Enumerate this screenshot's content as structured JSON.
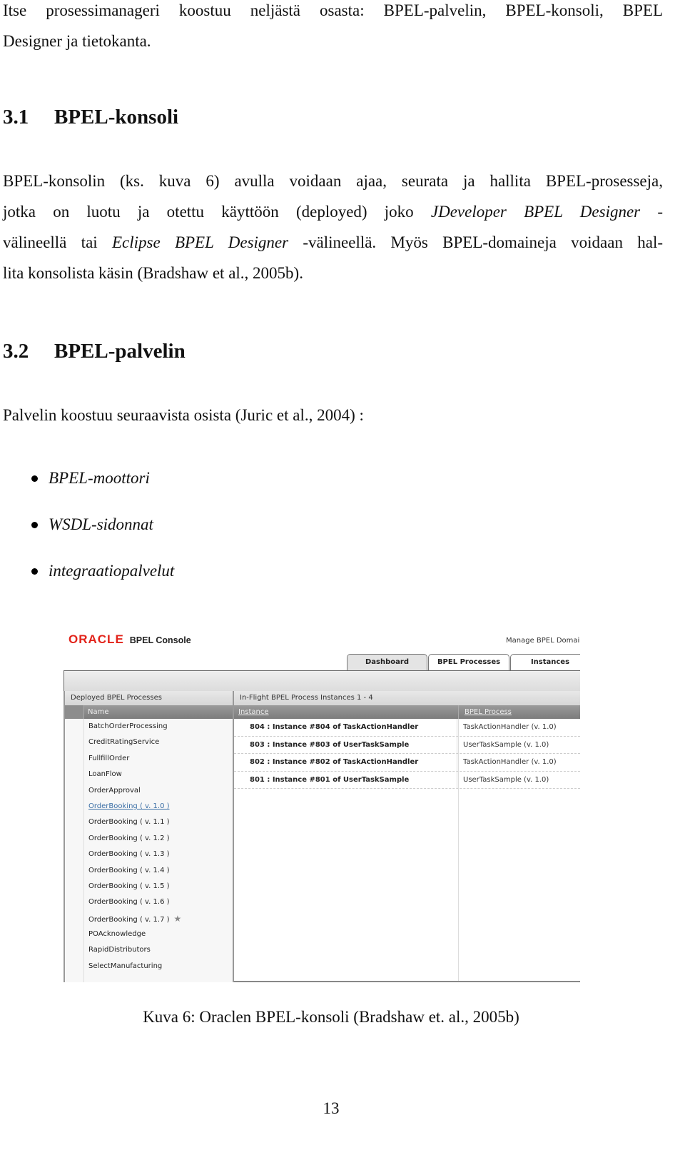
{
  "intro": {
    "line1": "Itse prosessimanageri koostuu neljästä osasta: BPEL-palvelin, BPEL-konsoli, BPEL",
    "line2": "Designer ja tietokanta."
  },
  "section1": {
    "number": "3.1",
    "title": "BPEL-konsoli",
    "lines": [
      [
        "BPEL-konsolin (ks. kuva 6) avulla voidaan ajaa, seurata ja hallita BPEL-prosesseja,"
      ],
      [
        "jotka on luotu ja otettu käyttöön (deployed) joko ",
        "JDeveloper BPEL Designer",
        " -"
      ],
      [
        "välineellä tai ",
        "Eclipse BPEL Designer",
        " -välineellä. Myös BPEL-domaineja voidaan hal-"
      ],
      [
        "lita konsolista käsin (Bradshaw et al., 2005b)."
      ]
    ]
  },
  "section2": {
    "number": "3.2",
    "title": "BPEL-palvelin",
    "paragraph": "Palvelin koostuu seuraavista osista (Juric et al., 2004) :",
    "bullets": [
      "BPEL-moottori",
      "WSDL-sidonnat",
      "integraatiopalvelut"
    ]
  },
  "console": {
    "brand": "ORACLE",
    "product": "BPEL Console",
    "manage_link": "Manage BPEL Domain",
    "tabs": [
      {
        "label": "Dashboard",
        "active": true
      },
      {
        "label": "BPEL Processes",
        "active": false
      },
      {
        "label": "Instances",
        "active": false
      }
    ],
    "deployed": {
      "title": "Deployed BPEL Processes",
      "column": "Name",
      "items": [
        {
          "name": "BatchOrderProcessing"
        },
        {
          "name": "CreditRatingService"
        },
        {
          "name": "FullfillOrder"
        },
        {
          "name": "LoanFlow"
        },
        {
          "name": "OrderApproval"
        },
        {
          "name": "OrderBooking ( v. 1.0 )",
          "link": true
        },
        {
          "name": "OrderBooking ( v. 1.1 )"
        },
        {
          "name": "OrderBooking ( v. 1.2 )"
        },
        {
          "name": "OrderBooking ( v. 1.3 )"
        },
        {
          "name": "OrderBooking ( v. 1.4 )"
        },
        {
          "name": "OrderBooking ( v. 1.5 )"
        },
        {
          "name": "OrderBooking ( v. 1.6 )"
        },
        {
          "name": "OrderBooking ( v. 1.7 )",
          "default_star": "★"
        },
        {
          "name": "POAcknowledge"
        },
        {
          "name": "RapidDistributors"
        },
        {
          "name": "SelectManufacturing"
        }
      ]
    },
    "inflight": {
      "title": "In-Flight BPEL Process Instances 1 - 4",
      "columns": [
        "Instance",
        "BPEL Process"
      ],
      "rows": [
        {
          "instance": "804 : Instance #804 of TaskActionHandler",
          "process": "TaskActionHandler (v. 1.0)"
        },
        {
          "instance": "803 : Instance #803 of UserTaskSample",
          "process": "UserTaskSample (v. 1.0)"
        },
        {
          "instance": "802 : Instance #802 of TaskActionHandler",
          "process": "TaskActionHandler (v. 1.0)"
        },
        {
          "instance": "801 : Instance #801 of UserTaskSample",
          "process": "UserTaskSample (v. 1.0)"
        }
      ]
    }
  },
  "caption": "Kuva 6: Oraclen BPEL-konsoli (Bradshaw et. al., 2005b)",
  "page_number": "13"
}
